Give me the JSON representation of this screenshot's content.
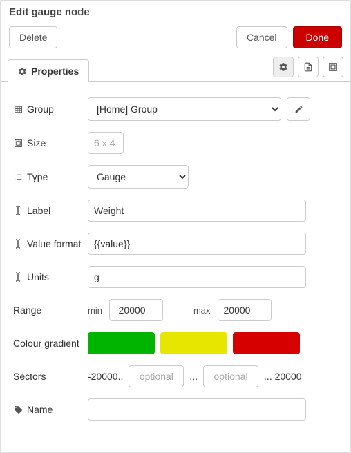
{
  "header": {
    "title": "Edit gauge node"
  },
  "buttons": {
    "delete": "Delete",
    "cancel": "Cancel",
    "done": "Done"
  },
  "tabs": {
    "properties": "Properties"
  },
  "labels": {
    "group": "Group",
    "size": "Size",
    "type": "Type",
    "label": "Label",
    "value_format": "Value format",
    "units": "Units",
    "range": "Range",
    "range_min": "min",
    "range_max": "max",
    "colour_gradient": "Colour gradient",
    "sectors": "Sectors",
    "name": "Name"
  },
  "fields": {
    "group_value": "[Home] Group",
    "size_placeholder": "6 x 4",
    "type_value": "Gauge",
    "label_value": "Weight",
    "value_format_value": "{{value}}",
    "units_value": "g",
    "range_min_value": "-20000",
    "range_max_value": "20000",
    "sectors_prefix": "-20000..",
    "sectors_opt_placeholder": "optional",
    "sectors_dots": "...",
    "sectors_suffix": "... 20000",
    "name_value": ""
  },
  "colors": {
    "swatch1": "#00b400",
    "swatch2": "#e6e600",
    "swatch3": "#d60000"
  }
}
